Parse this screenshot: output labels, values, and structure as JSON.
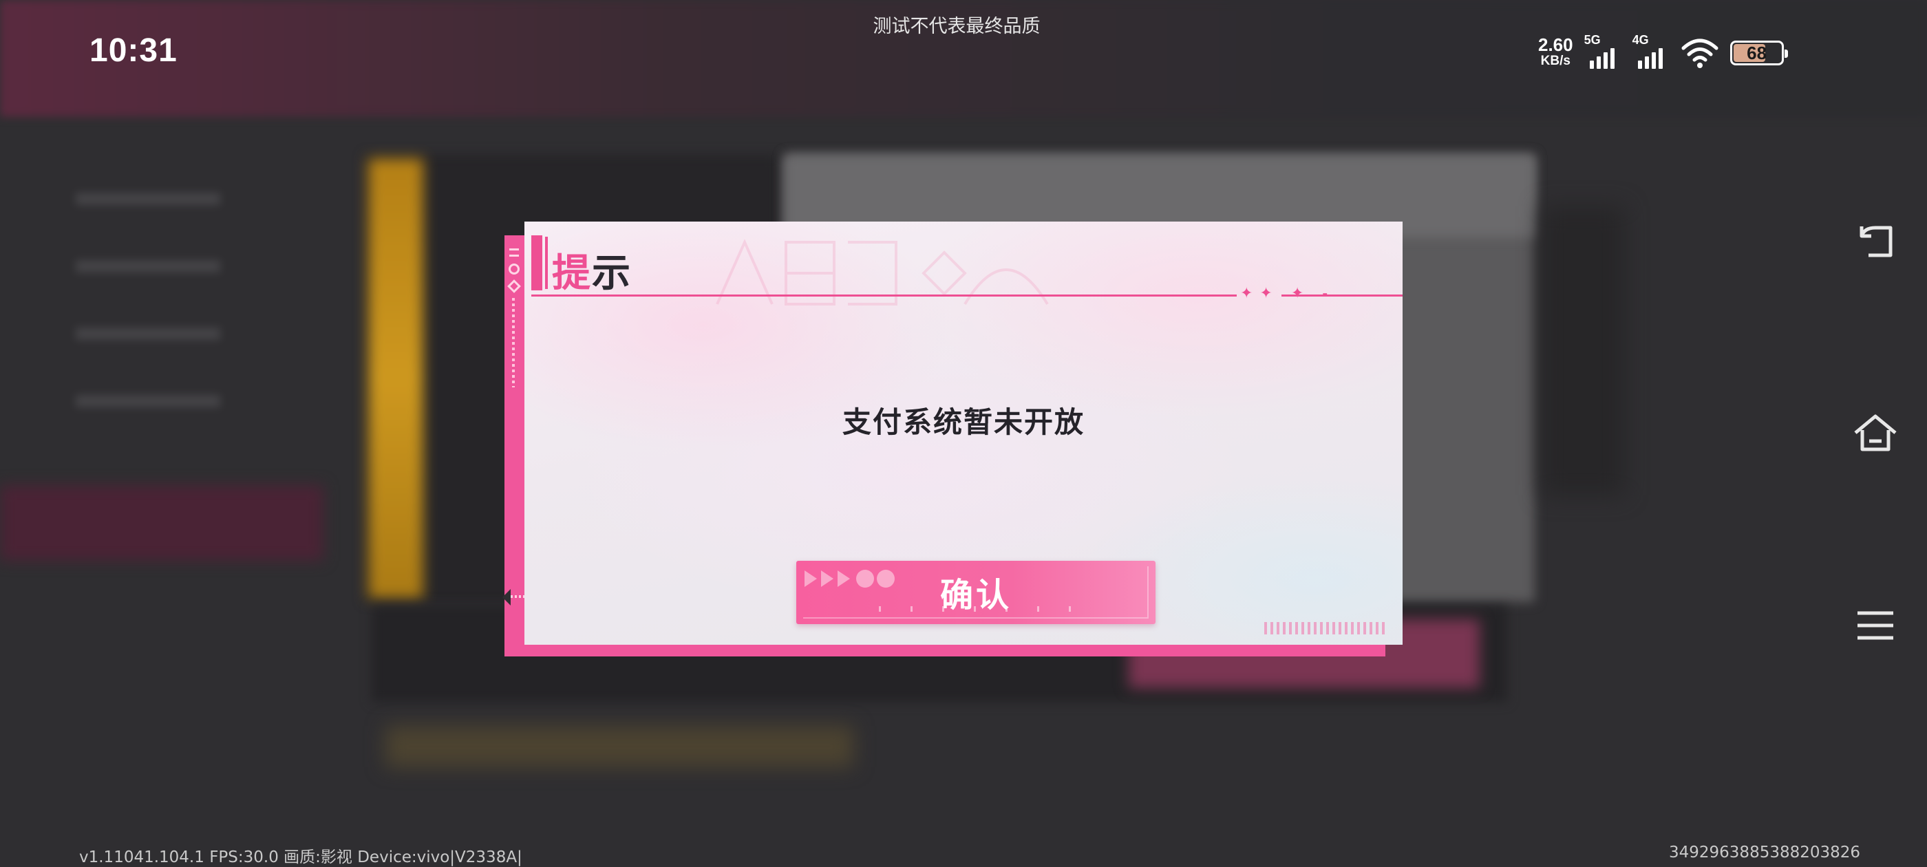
{
  "status_bar": {
    "time": "10:31",
    "test_banner": "测试不代表最终品质",
    "net_speed_value": "2.60",
    "net_speed_unit": "KB/s",
    "signal_1_label": "5G",
    "signal_2_label": "4G",
    "battery_level": "68"
  },
  "dialog": {
    "title_char_1": "提",
    "title_char_2": "示",
    "message": "支付系统暂未开放",
    "confirm_label": "确认",
    "accent_color": "#ee4f93"
  },
  "footer": {
    "build_info": "v1.11041.104.1 FPS:30.0 画质:影视 Device:vivo|V2338A|",
    "user_id": "3492963885388203826"
  },
  "system_nav": {
    "icons": [
      "back-icon",
      "home-icon",
      "menu-icon"
    ]
  }
}
